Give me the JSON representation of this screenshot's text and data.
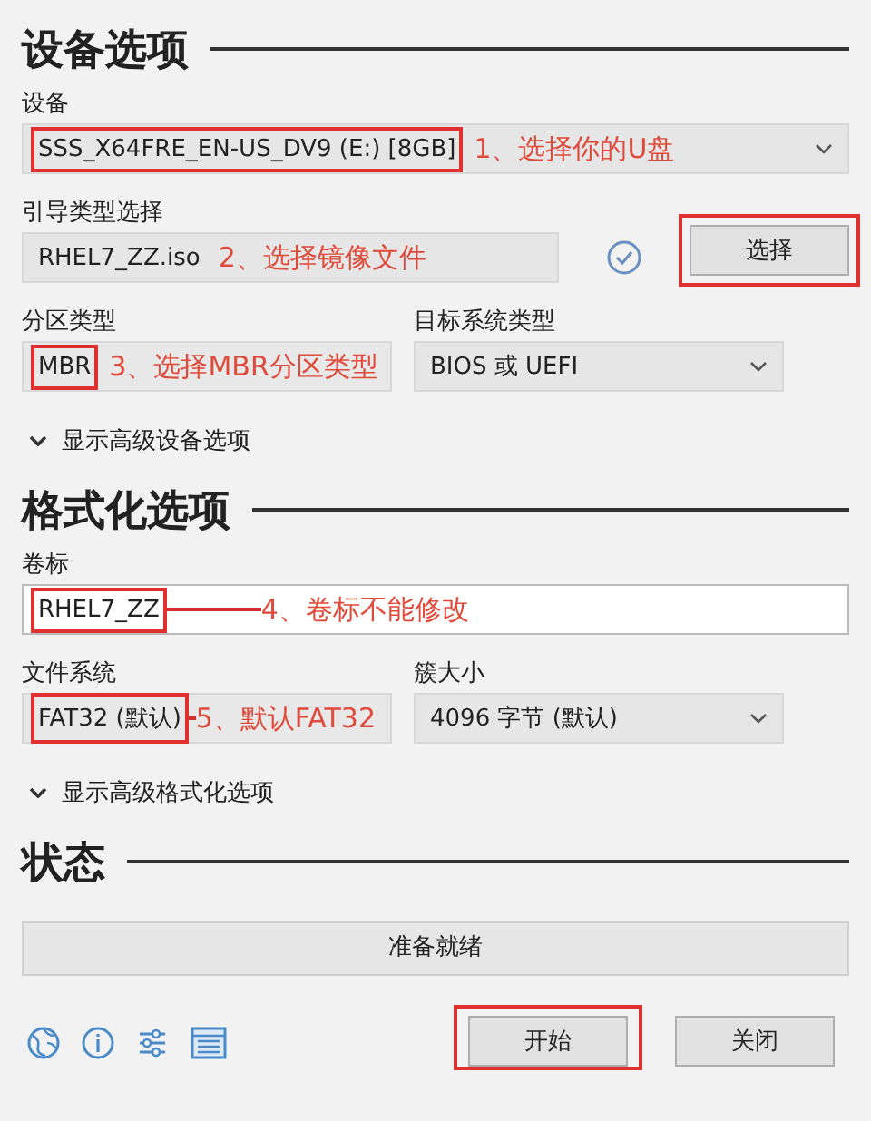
{
  "sections": [
    {
      "title": "设备选项",
      "rows": [
        {
          "fields": [
            {
              "label": "设备",
              "kind": "dropdown",
              "value": "SSS_X64FRE_EN-US_DV9 (E:) [8GB]",
              "highlighted": true,
              "note": "1、选择你的U盘"
            }
          ]
        },
        {
          "fields": [
            {
              "label": "引导类型选择",
              "kind": "dropdown-cut",
              "value": "RHEL7_ZZ.iso",
              "highlighted": false,
              "note": "2、选择镜像文件"
            }
          ],
          "check": true,
          "button": {
            "label": "选择",
            "highlighted": true
          }
        },
        {
          "fields": [
            {
              "label": "分区类型",
              "kind": "readonly",
              "value": "MBR",
              "highlighted": true,
              "note": "3、选择MBR分区类型"
            },
            {
              "label": "目标系统类型",
              "kind": "dropdown",
              "value": "BIOS 或 UEFI",
              "highlighted": false
            }
          ]
        }
      ],
      "expander": "显示高级设备选项"
    },
    {
      "title": "格式化选项",
      "rows": [
        {
          "fields": [
            {
              "label": "卷标",
              "kind": "text",
              "value": "RHEL7_ZZ",
              "highlighted": true,
              "note": "4、卷标不能修改",
              "leader": true
            }
          ]
        },
        {
          "fields": [
            {
              "label": "文件系统",
              "kind": "readonly",
              "value": "FAT32 (默认)",
              "highlighted": true,
              "note": "5、默认FAT32",
              "leader": true
            },
            {
              "label": "簇大小",
              "kind": "dropdown",
              "value": "4096 字节 (默认)",
              "highlighted": false
            }
          ]
        }
      ],
      "expander": "显示高级格式化选项"
    },
    {
      "title": "状态",
      "status": "准备就绪"
    }
  ],
  "buttons": [
    {
      "label": "开始",
      "highlighted": true
    },
    {
      "label": "关闭",
      "highlighted": false
    }
  ]
}
